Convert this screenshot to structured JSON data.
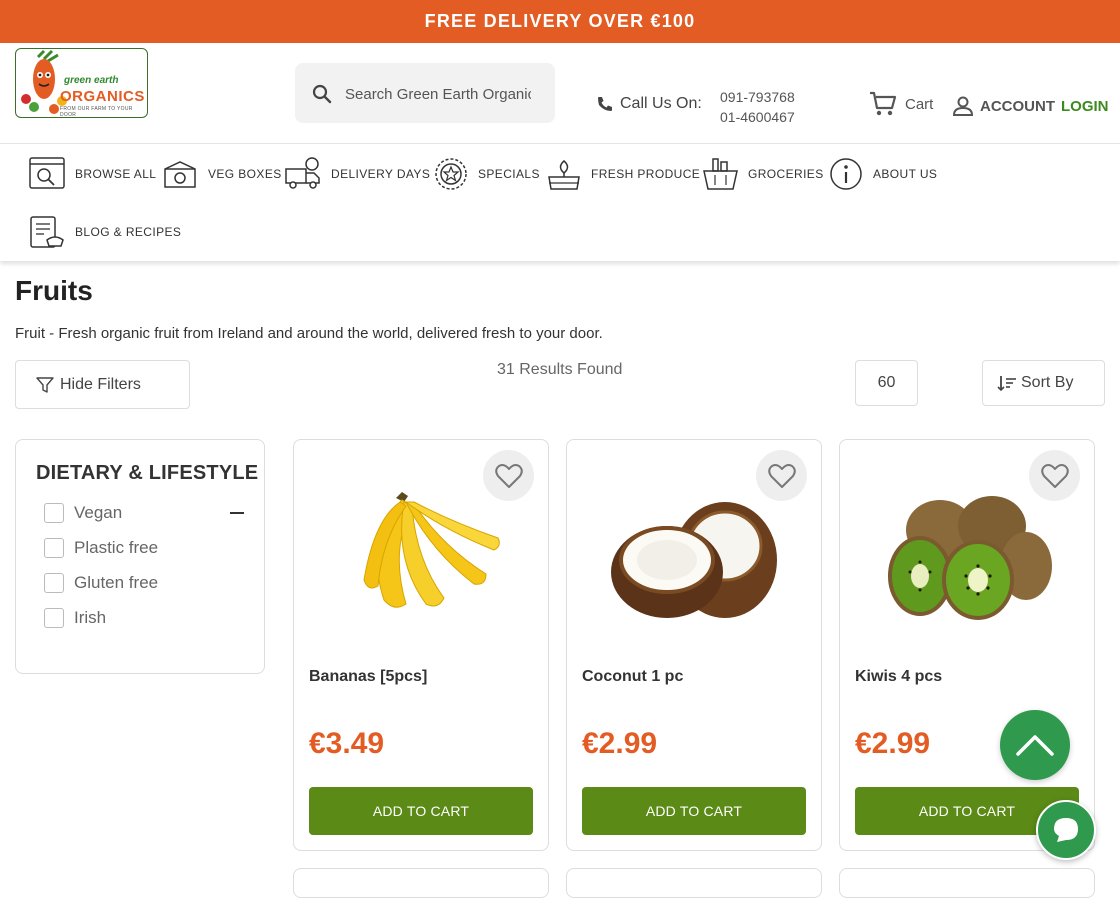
{
  "promo": {
    "text": "FREE DELIVERY OVER €100"
  },
  "logo": {
    "line1": "green earth",
    "line2": "ORGANICS",
    "line3": "FROM OUR FARM TO YOUR DOOR"
  },
  "search": {
    "placeholder": "Search Green Earth Organics"
  },
  "contact": {
    "label": "Call Us On:",
    "phone1": "091-793768",
    "phone2": "01-4600467"
  },
  "cart": {
    "label": "Cart"
  },
  "account": {
    "label": "ACCOUNT",
    "login": "LOGIN"
  },
  "nav": [
    {
      "label": "BROWSE ALL",
      "icon": "browse-icon"
    },
    {
      "label": "VEG BOXES",
      "icon": "veg-box-icon"
    },
    {
      "label": "DELIVERY DAYS",
      "icon": "delivery-truck-icon"
    },
    {
      "label": "SPECIALS",
      "icon": "star-badge-icon"
    },
    {
      "label": "FRESH PRODUCE",
      "icon": "produce-icon"
    },
    {
      "label": "GROCERIES",
      "icon": "basket-icon"
    },
    {
      "label": "ABOUT US",
      "icon": "info-icon"
    },
    {
      "label": "BLOG & RECIPES",
      "icon": "recipe-icon"
    }
  ],
  "page": {
    "title": "Fruits",
    "description": "Fruit - Fresh organic fruit from Ireland and around the world, delivered fresh to your door."
  },
  "toolbar": {
    "hide_filters": "Hide Filters",
    "results": "31 Results Found",
    "per_page": "60",
    "sort_by": "Sort By"
  },
  "filters": {
    "heading": "DIETARY & LIFESTYLE",
    "options": [
      "Vegan",
      "Plastic free",
      "Gluten free",
      "Irish"
    ]
  },
  "products": [
    {
      "name": "Bananas [5pcs]",
      "price": "€3.49",
      "button": "ADD TO CART"
    },
    {
      "name": "Coconut 1 pc",
      "price": "€2.99",
      "button": "ADD TO CART"
    },
    {
      "name": "Kiwis 4 pcs",
      "price": "€2.99",
      "button": "ADD TO CART"
    }
  ],
  "colors": {
    "brand_orange": "#e35c24",
    "brand_green": "#5b8a17",
    "accent_green": "#2f9a4e"
  }
}
